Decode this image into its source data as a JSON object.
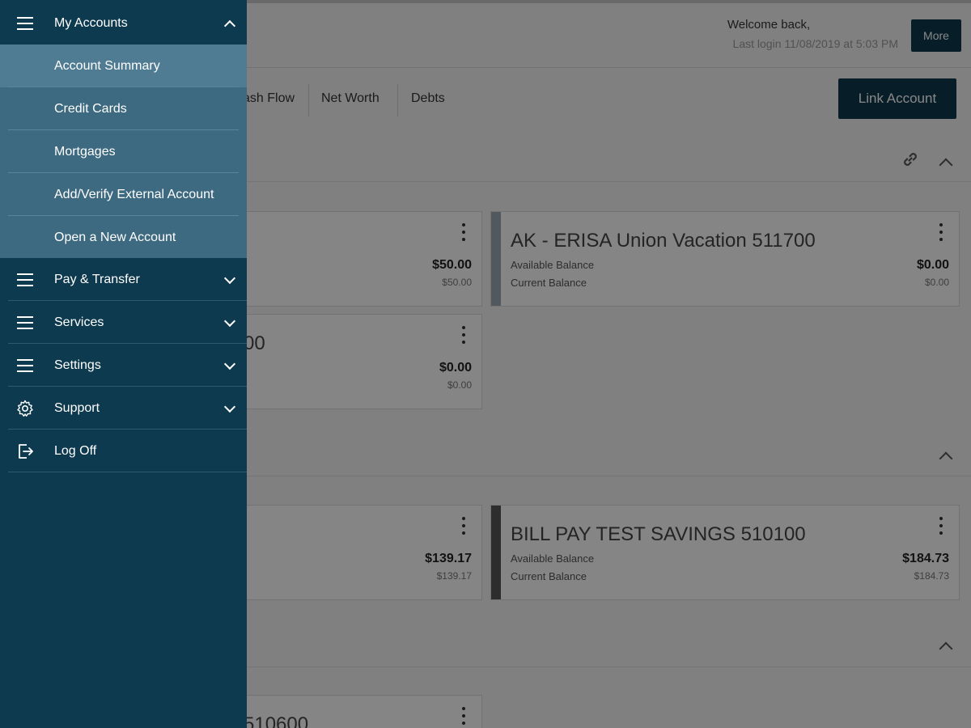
{
  "header": {
    "welcome": "Welcome back,",
    "last_login": "Last login 11/08/2019 at 5:03 PM",
    "more_label": "More"
  },
  "tabs": [
    "ash Flow",
    "Net Worth",
    "Debts"
  ],
  "link_account_label": "Link Account",
  "cards": [
    {
      "name": "",
      "label1": "",
      "label2": "",
      "amount1": "$50.00",
      "amount2": "$50.00",
      "accent": "none"
    },
    {
      "name": "AK - ERISA Union Vacation 511700",
      "label1": "Available Balance",
      "label2": "Current Balance",
      "amount1": "$0.00",
      "amount2": "$0.00",
      "accent": "#9aa9b3"
    },
    {
      "name": "00",
      "label1": "",
      "label2": "",
      "amount1": "$0.00",
      "amount2": "$0.00",
      "accent": "none"
    },
    {
      "name": "",
      "label1": "",
      "label2": "",
      "amount1": "$139.17",
      "amount2": "$139.17",
      "accent": "none"
    },
    {
      "name": "BILL PAY TEST SAVINGS 510100",
      "label1": "Available Balance",
      "label2": "Current Balance",
      "amount1": "$184.73",
      "amount2": "$184.73",
      "accent": "#555555"
    },
    {
      "name": "510600",
      "label1": "",
      "label2": "",
      "amount1": "",
      "amount2": "",
      "accent": "none"
    }
  ],
  "drawer": {
    "my_accounts": {
      "label": "My Accounts",
      "icon": "hamburger-icon"
    },
    "submenu": [
      "Account Summary",
      "Credit Cards",
      "Mortgages",
      "Add/Verify External Account",
      "Open a New Account"
    ],
    "items": [
      {
        "label": "Pay & Transfer",
        "icon": "hamburger-icon"
      },
      {
        "label": "Services",
        "icon": "hamburger-icon"
      },
      {
        "label": "Settings",
        "icon": "hamburger-icon"
      },
      {
        "label": "Support",
        "icon": "gear-icon"
      },
      {
        "label": "Log Off",
        "icon": "logout-icon"
      }
    ]
  },
  "colors": {
    "drawer_bg": "#0e3a4f",
    "submenu_bg": "#3d6a80",
    "submenu_active": "#4f7c92",
    "button_bg": "#0e3a4f"
  }
}
